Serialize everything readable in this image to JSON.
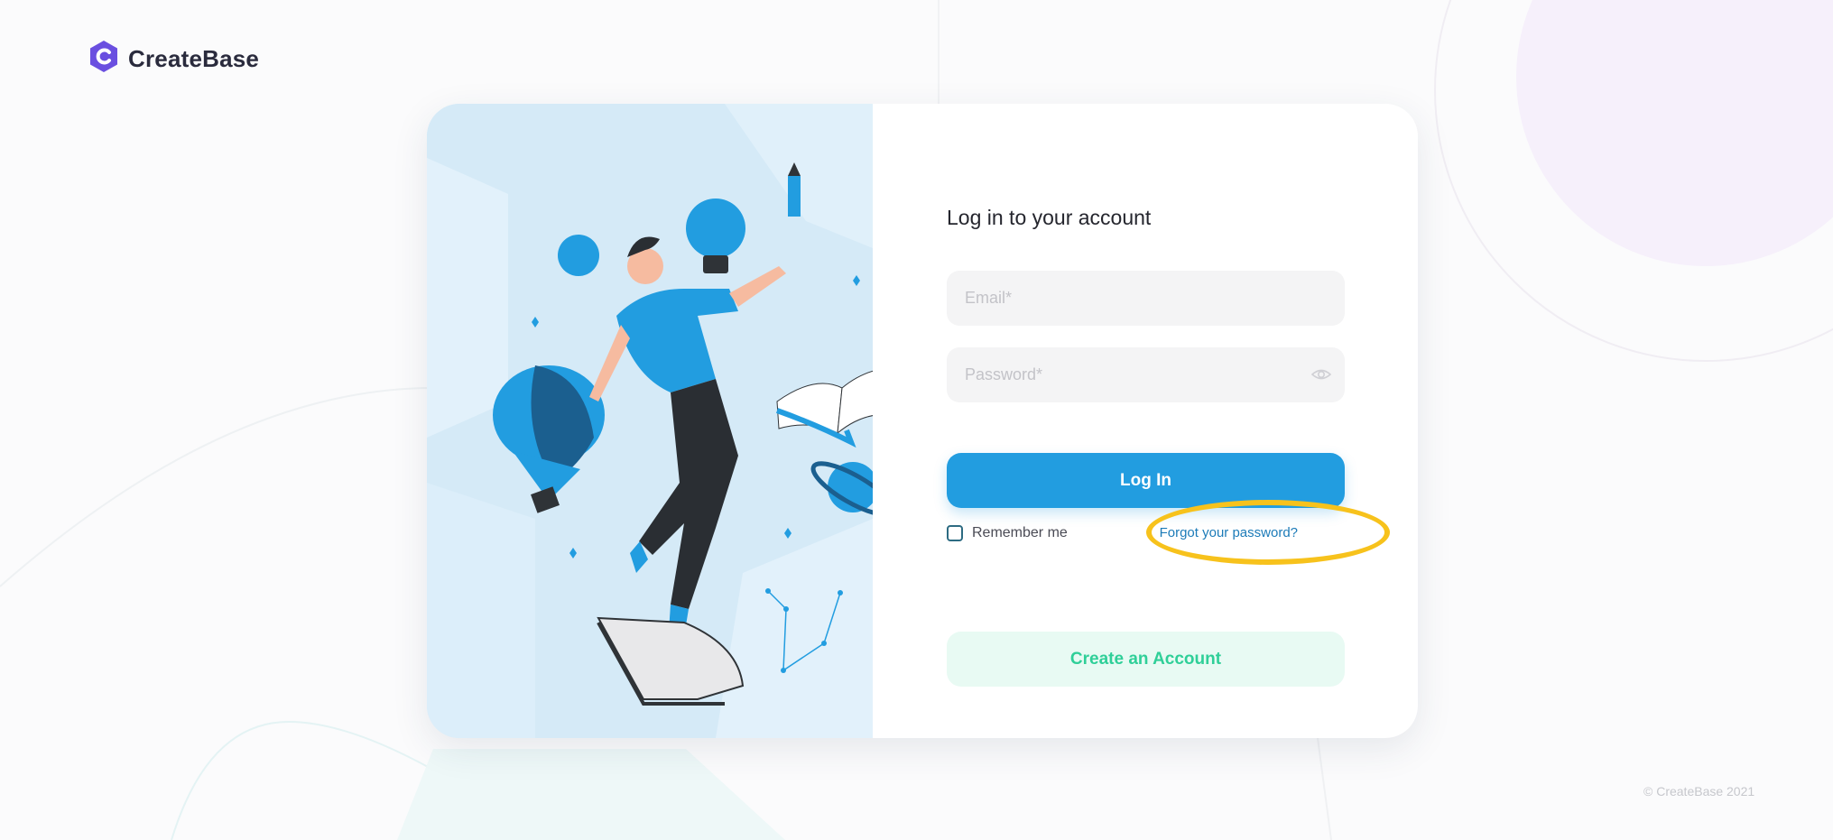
{
  "brand": {
    "name": "CreateBase"
  },
  "login": {
    "heading": "Log in to your account",
    "email_placeholder": "Email*",
    "password_placeholder": "Password*",
    "login_label": "Log In",
    "remember_label": "Remember me",
    "forgot_label": "Forgot your password?",
    "create_label": "Create an Account"
  },
  "footer": {
    "copyright": "© CreateBase 2021"
  },
  "icons": [
    "createbase-logo-icon",
    "eye-icon"
  ],
  "colors": {
    "accent": "#229de0",
    "brand_purple": "#6a4fe0",
    "create_text": "#2fcf98",
    "create_bg": "#e8faf3",
    "highlight": "#f7c21c"
  }
}
